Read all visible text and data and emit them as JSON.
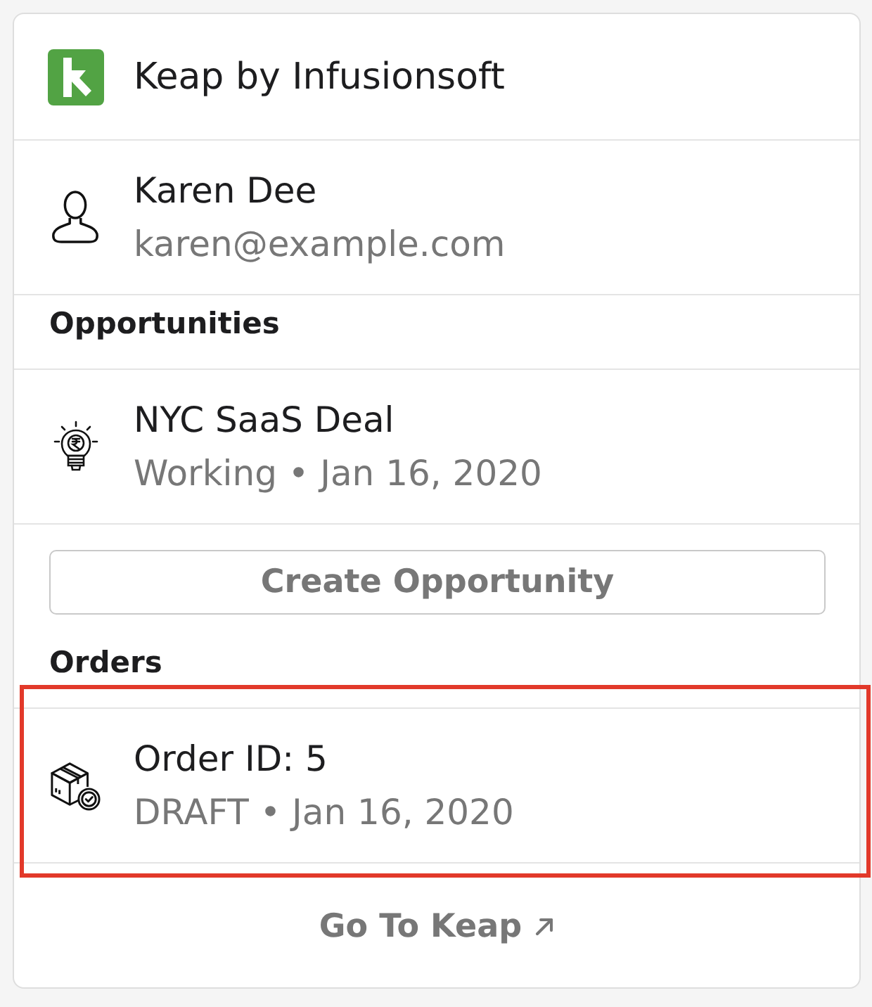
{
  "app": {
    "title": "Keap by Infusionsoft"
  },
  "contact": {
    "name": "Karen Dee",
    "email": "karen@example.com"
  },
  "opportunities": {
    "heading": "Opportunities",
    "items": [
      {
        "title": "NYC SaaS Deal",
        "subtitle": "Working • Jan 16, 2020",
        "kind": "opportunity",
        "highlighted": false
      }
    ],
    "create_button": "Create Opportunity"
  },
  "orders": {
    "heading": "Orders",
    "items": [
      {
        "title": "Order ID: 5",
        "subtitle": "DRAFT • Jan 16, 2020",
        "kind": "order",
        "highlighted": true
      }
    ]
  },
  "footer_link": {
    "label": "Go To Keap"
  }
}
